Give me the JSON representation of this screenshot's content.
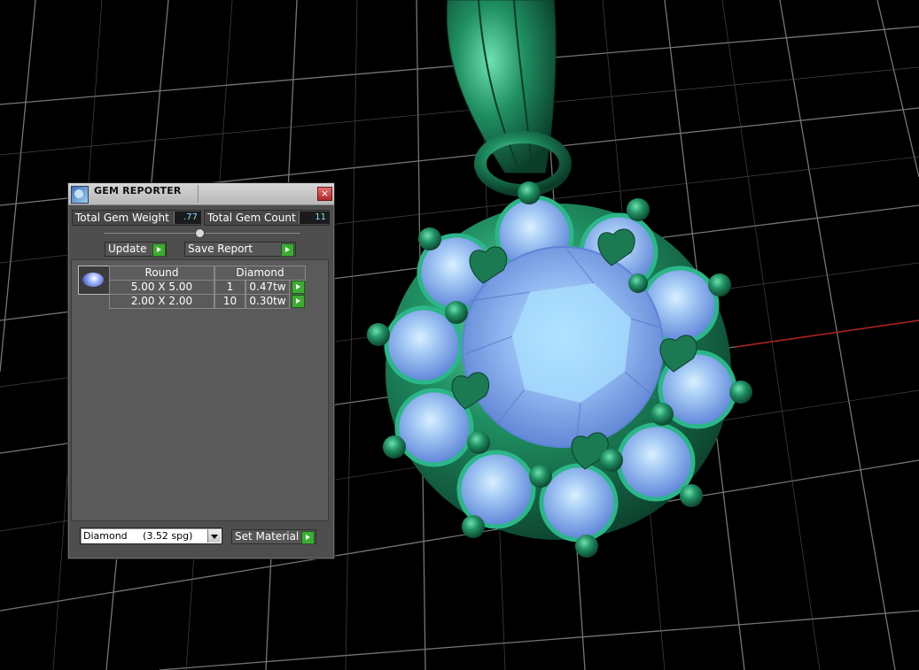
{
  "panel": {
    "title": "GEM REPORTER",
    "close_glyph": "×",
    "total_weight_label": "Total Gem Weight",
    "total_weight_value": ".77",
    "total_count_label": "Total Gem Count",
    "total_count_value": "11",
    "update_label": "Update",
    "save_report_label": "Save Report",
    "table": {
      "shape_header": "Round",
      "material_header": "Diamond",
      "rows": [
        {
          "size": "5.00 X 5.00",
          "count": "1",
          "weight": "0.47tw"
        },
        {
          "size": "2.00 X 2.00",
          "count": "10",
          "weight": "0.30tw"
        }
      ]
    },
    "material_select": "Diamond     (3.52 spg)",
    "set_material_label": "Set Material",
    "icons": [
      "gem-reporter-app-icon",
      "close-icon",
      "slider-handle",
      "arrow-right-icon",
      "gem-thumbnail",
      "chevron-down-icon"
    ]
  },
  "colors": {
    "panel_bg": "#4e4e4e",
    "metal": "#1f8f62",
    "gem": "#8ab4f0",
    "grid": "#8a8a8a",
    "axis_red": "#b02020",
    "button_green": "#3cad32",
    "value_text": "#8fd8ff"
  }
}
